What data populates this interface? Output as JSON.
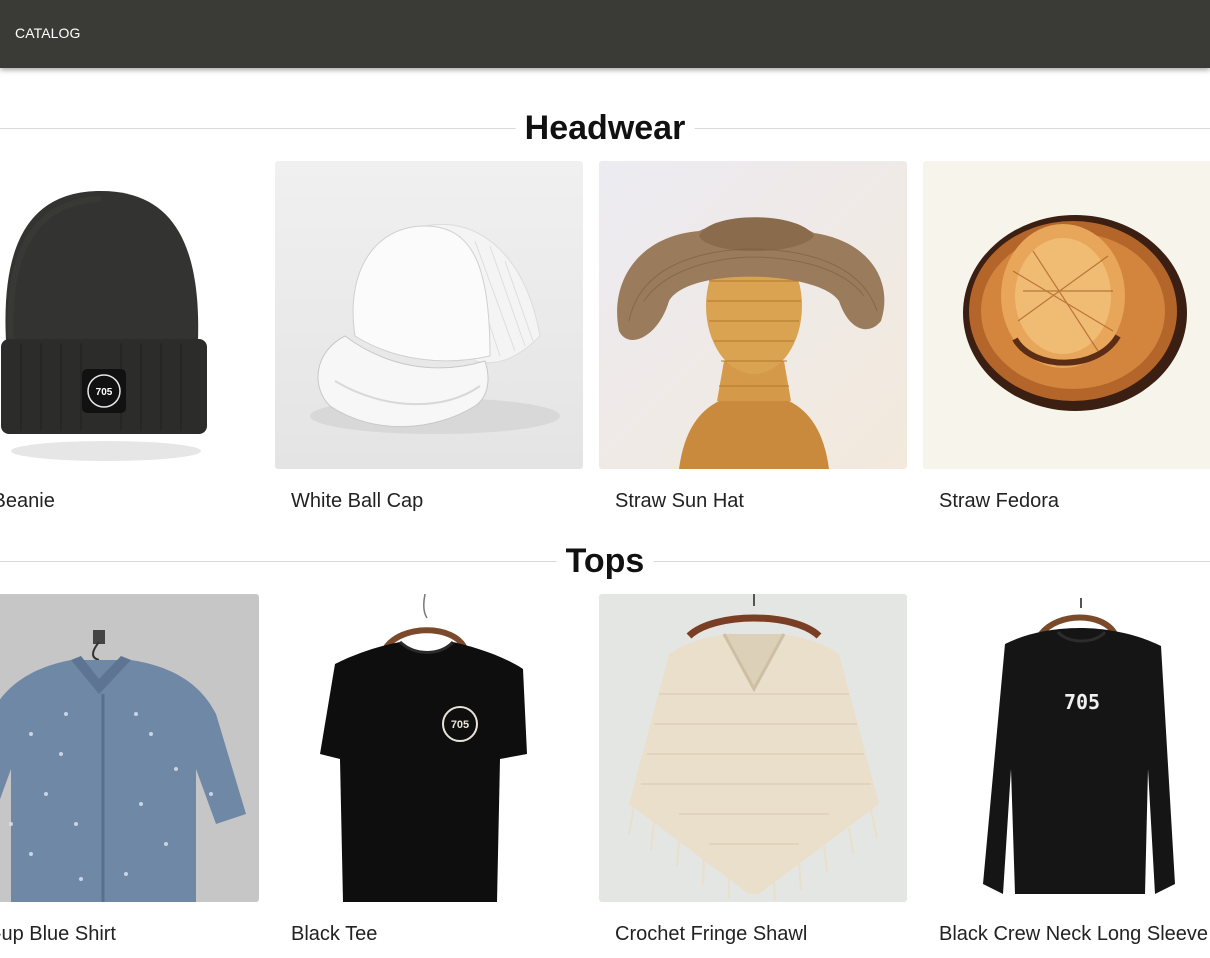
{
  "header": {
    "nav_label": "CATALOG"
  },
  "sections": [
    {
      "title": "Headwear",
      "products": [
        {
          "name": "Black Beanie",
          "visible_name": "ck Beanie"
        },
        {
          "name": "White Ball Cap"
        },
        {
          "name": "Straw Sun Hat"
        },
        {
          "name": "Straw Fedora"
        }
      ]
    },
    {
      "title": "Tops",
      "products": [
        {
          "name": "Button-up Blue Shirt",
          "visible_name": "ton-up Blue Shirt"
        },
        {
          "name": "Black Tee"
        },
        {
          "name": "Crochet Fringe Shawl"
        },
        {
          "name": "Black Crew Neck Long Sleeve"
        }
      ]
    }
  ],
  "brand_marks": {
    "logo_text": "705"
  },
  "colors": {
    "header_bg": "#3a3b36",
    "header_text": "#ffffff",
    "divider": "#d9d9d9"
  }
}
